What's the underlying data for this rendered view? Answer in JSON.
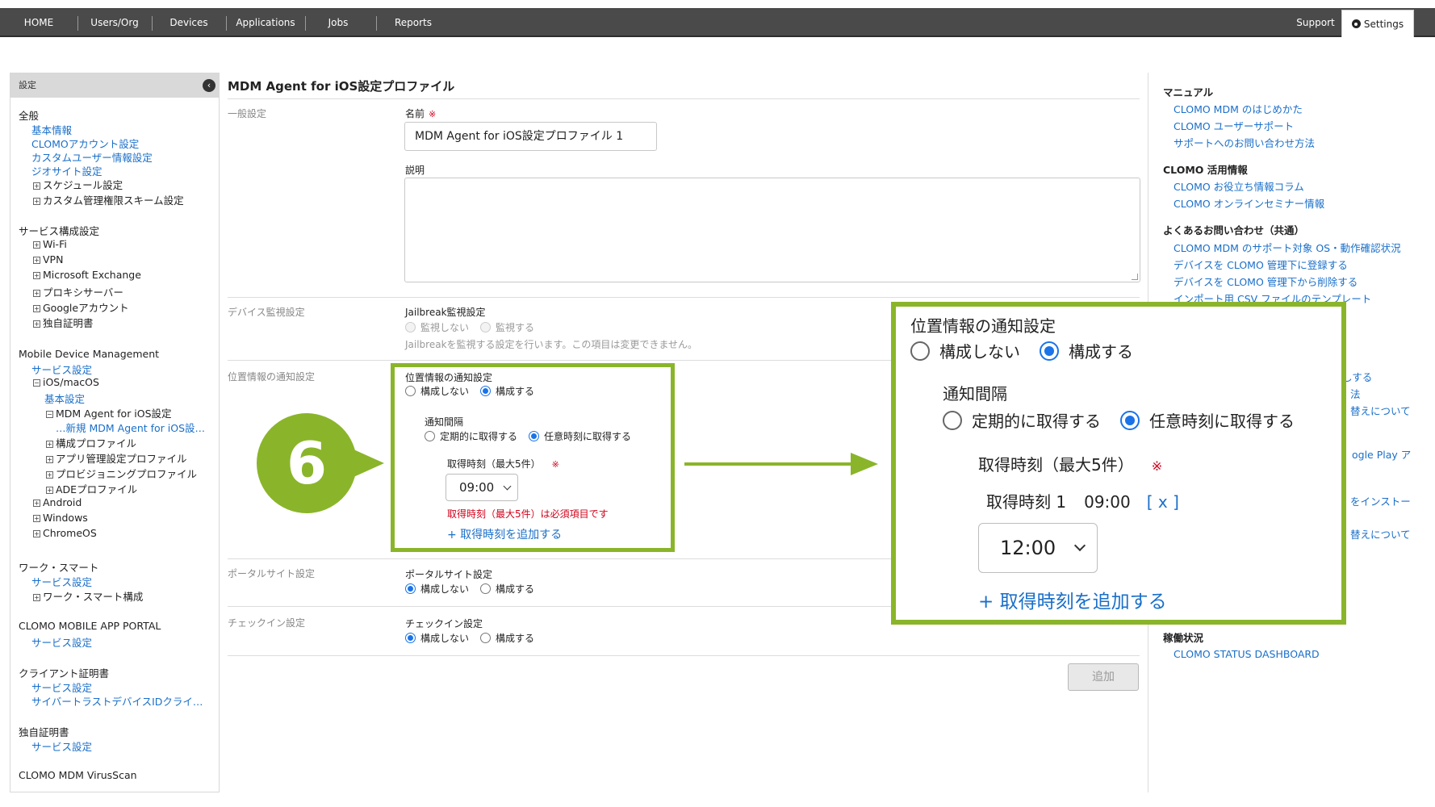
{
  "nav": {
    "items": [
      "HOME",
      "Users/Org",
      "Devices",
      "Applications",
      "Jobs",
      "Reports"
    ],
    "support": "Support",
    "settings": "Settings"
  },
  "sidebar": {
    "header": "設定",
    "general": {
      "title": "全般",
      "links": [
        "基本情報",
        "CLOMOアカウント設定",
        "カスタムユーザー情報設定",
        "ジオサイト設定"
      ],
      "trees": [
        "スケジュール設定",
        "カスタム管理権限スキーム設定"
      ]
    },
    "service_config": {
      "title": "サービス構成設定",
      "trees": [
        "Wi-Fi",
        "VPN",
        "Microsoft Exchange",
        "プロキシサーバー",
        "Googleアカウント",
        "独自証明書"
      ]
    },
    "mdm": {
      "title": "Mobile Device Management",
      "service_settings": "サービス設定",
      "ios": "iOS/macOS",
      "basic": "基本設定",
      "agent": "MDM Agent for iOS設定",
      "new_agent": "…新規 MDM Agent for iOS設…",
      "profiles": [
        "構成プロファイル",
        "アプリ管理設定プロファイル",
        "プロビジョニングプロファイル",
        "ADEプロファイル"
      ],
      "platforms": [
        "Android",
        "Windows",
        "ChromeOS"
      ]
    },
    "worksmart": {
      "title": "ワーク・スマート",
      "service_settings": "サービス設定",
      "tree": "ワーク・スマート構成"
    },
    "portal": {
      "title": "CLOMO MOBILE APP PORTAL",
      "service_settings": "サービス設定"
    },
    "client_cert": {
      "title": "クライアント証明書",
      "service_settings": "サービス設定",
      "link2": "サイバートラストデバイスIDクライ…"
    },
    "own_cert": {
      "title": "独自証明書",
      "service_settings": "サービス設定"
    },
    "virusscan": {
      "title": "CLOMO MDM VirusScan"
    }
  },
  "main": {
    "title": "MDM Agent for iOS設定プロファイル",
    "general": {
      "section": "一般設定",
      "name_label": "名前",
      "required_mark": "※",
      "name_value": "MDM Agent for iOS設定プロファイル 1",
      "desc_label": "説明"
    },
    "device_monitor": {
      "section": "デバイス監視設定",
      "label": "Jailbreak監視設定",
      "opt_off": "監視しない",
      "opt_on": "監視する",
      "hint": "Jailbreakを監視する設定を行います。この項目は変更できません。"
    },
    "location": {
      "section": "位置情報の通知設定",
      "label": "位置情報の通知設定",
      "opt_off": "構成しない",
      "opt_on": "構成する",
      "interval_label": "通知間隔",
      "interval_periodic": "定期的に取得する",
      "interval_any": "任意時刻に取得する",
      "time_label": "取得時刻（最大5件）",
      "time_value": "09:00",
      "error": "取得時刻（最大5件）は必須項目です",
      "add_time": "+ 取得時刻を追加する"
    },
    "portal": {
      "section": "ポータルサイト設定",
      "label": "ポータルサイト設定",
      "opt_off": "構成しない",
      "opt_on": "構成する"
    },
    "checkin": {
      "section": "チェックイン設定",
      "label": "チェックイン設定",
      "opt_off": "構成しない",
      "opt_on": "構成する"
    },
    "add_button": "追加"
  },
  "step": {
    "number": "6"
  },
  "zoom": {
    "title": "位置情報の通知設定",
    "opt_off": "構成しない",
    "opt_on": "構成する",
    "interval_label": "通知間隔",
    "interval_periodic": "定期的に取得する",
    "interval_any": "任意時刻に取得する",
    "time_label": "取得時刻（最大5件）",
    "required_mark": "※",
    "time1_label": "取得時刻 1",
    "time1_value": "09:00",
    "remove": "[ x ]",
    "select_value": "12:00",
    "add_time": "+ 取得時刻を追加する"
  },
  "help": {
    "manual_title": "マニュアル",
    "manual_links": [
      "CLOMO MDM のはじめかた",
      "CLOMO ユーザーサポート",
      "サポートへのお問い合わせ方法"
    ],
    "tips_title": "CLOMO 活用情報",
    "tips_links": [
      "CLOMO お役立ち情報コラム",
      "CLOMO オンラインセミナー情報"
    ],
    "faq_title": "よくあるお問い合わせ（共通）",
    "faq_links": [
      "CLOMO MDM のサポート対象 OS・動作確認状況",
      "デバイスを CLOMO 管理下に登録する",
      "デバイスを CLOMO 管理下から削除する",
      "インポート用 CSV ファイルのテンプレート"
    ],
    "partial_links": [
      "しする",
      "法",
      "替えについて",
      "ogle Play ア",
      "をインストー",
      "替えについて"
    ],
    "status_title": "稼働状況",
    "status_link": "CLOMO STATUS DASHBOARD"
  }
}
